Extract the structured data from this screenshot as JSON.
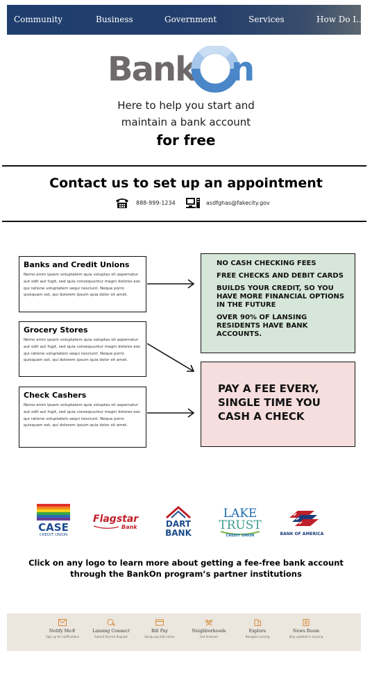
{
  "nav": {
    "items": [
      "Community",
      "Business",
      "Government",
      "Services",
      "How Do I..."
    ]
  },
  "logo": {
    "text_bank": "Bank",
    "text_on": "On"
  },
  "hero": {
    "line1": "Here to help you start and",
    "line2": "maintain a bank account",
    "emphasis": "for free"
  },
  "contact": {
    "title": "Contact us to set up an appointment",
    "phone": "888-999-1234",
    "email": "asdfghas@fakecity.gov",
    "phone_icon": "phone-icon",
    "computer_icon": "computer-icon"
  },
  "options": [
    {
      "title": "Banks and Credit Unions",
      "body": "Nemo enim ipsam voluptatem quia voluptas sit aspernatur aut odit aut fugit, sed quia consequuntur magni dolores eos qui ratione voluptatem sequi nesciunt. Neque porro quisquam est, qui dolorem ipsum quia dolor sit amet."
    },
    {
      "title": "Grocery Stores",
      "body": "Nemo enim ipsam voluptatem quia voluptas sit aspernatur aut odit aut fugit, sed quia consequuntur magni dolores eos qui ratione voluptatem sequi nesciunt. Neque porro quisquam est, qui dolorem ipsum quia dolor sit amet."
    },
    {
      "title": "Check Cashers",
      "body": "Nemo enim ipsam voluptatem quia voluptas sit aspernatur aut odit aut fugit, sed quia consequuntur magni dolores eos qui ratione voluptatem sequi nesciunt. Neque porro quisquam est, qui dolorem ipsum quia dolor sit amet."
    }
  ],
  "benefits": [
    "No cash checking fees",
    "Free checks and debit cards",
    "Builds your credit, so you have more financial options in the future",
    "Over 90% of Lansing residents have bank accounts."
  ],
  "fee_note": "Pay a fee every, single time you cash a check",
  "partners": {
    "case_top": "CASE",
    "case_sub": "CREDIT UNION",
    "flagstar": "Flagstar",
    "flagstar_sub": "Bank",
    "dart_1": "DART",
    "dart_2": "BANK",
    "lake": "LAKE",
    "trust": "TRUST",
    "lake_sub": "CREDIT UNION",
    "boa": "BANK OF AMERICA"
  },
  "cta": {
    "line1": "Click on any logo to learn more about getting a fee-free bank account",
    "line2": "through the BankOn program’s partner institutions"
  },
  "footer": {
    "items": [
      {
        "title": "Notify Me®",
        "sub": "Sign up for notifications",
        "icon": "envelope-icon"
      },
      {
        "title": "Lansing Connect",
        "sub": "Submit Service Request",
        "icon": "chat-icon"
      },
      {
        "title": "Bill Pay",
        "sub": "Easily pay bills online",
        "icon": "card-icon"
      },
      {
        "title": "Neighborhoods",
        "sub": "Get Involved",
        "icon": "people-icon"
      },
      {
        "title": "Explore",
        "sub": "Navigate Lansing",
        "icon": "building-icon"
      },
      {
        "title": "News Room",
        "sub": "Stay updated in Lansing",
        "icon": "newspaper-icon"
      }
    ],
    "icon_color": "#d98c3a"
  },
  "colors": {
    "nav_bg": "#243f6b",
    "logo_gray": "#6e6a6b",
    "logo_blue": "#4a86c8",
    "benefit_green": "#d6e6d9",
    "fee_pink": "#f5dedd",
    "footer_bg": "#ebe6de"
  }
}
